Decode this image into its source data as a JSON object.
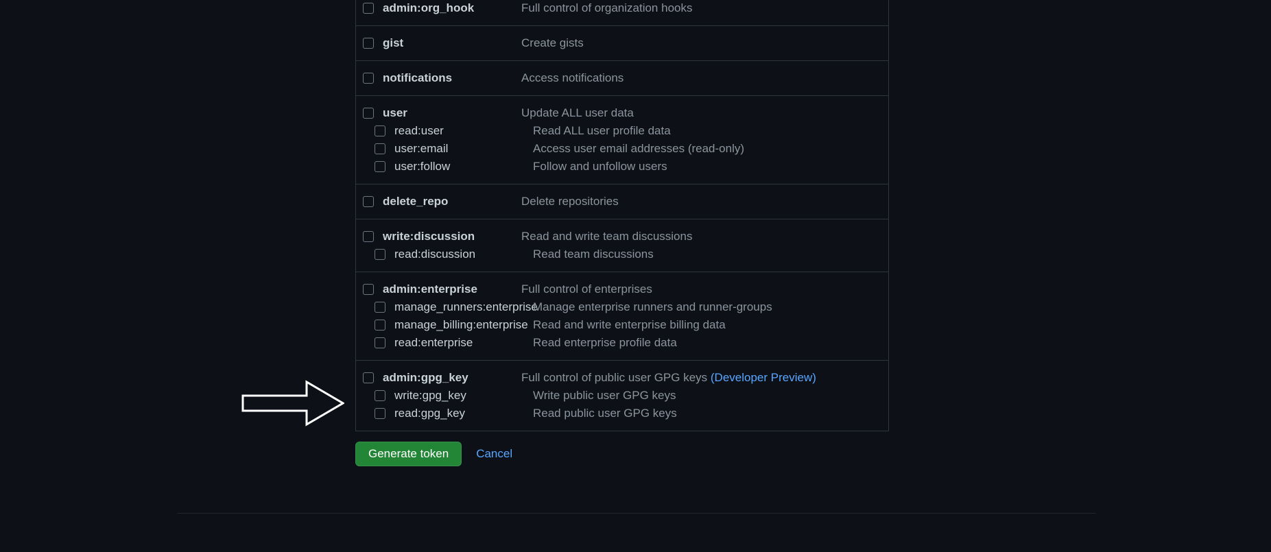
{
  "groups": [
    {
      "rows": [
        {
          "type": "parent",
          "label": "admin:org_hook",
          "desc": "Full control of organization hooks"
        }
      ]
    },
    {
      "rows": [
        {
          "type": "parent",
          "label": "gist",
          "desc": "Create gists"
        }
      ]
    },
    {
      "rows": [
        {
          "type": "parent",
          "label": "notifications",
          "desc": "Access notifications"
        }
      ]
    },
    {
      "rows": [
        {
          "type": "parent",
          "label": "user",
          "desc": "Update ALL user data"
        },
        {
          "type": "child",
          "label": "read:user",
          "desc": "Read ALL user profile data"
        },
        {
          "type": "child",
          "label": "user:email",
          "desc": "Access user email addresses (read-only)"
        },
        {
          "type": "child",
          "label": "user:follow",
          "desc": "Follow and unfollow users"
        }
      ]
    },
    {
      "rows": [
        {
          "type": "parent",
          "label": "delete_repo",
          "desc": "Delete repositories"
        }
      ]
    },
    {
      "rows": [
        {
          "type": "parent",
          "label": "write:discussion",
          "desc": "Read and write team discussions"
        },
        {
          "type": "child",
          "label": "read:discussion",
          "desc": "Read team discussions"
        }
      ]
    },
    {
      "rows": [
        {
          "type": "parent",
          "label": "admin:enterprise",
          "desc": "Full control of enterprises"
        },
        {
          "type": "child",
          "label": "manage_runners:enterprise",
          "desc": "Manage enterprise runners and runner-groups"
        },
        {
          "type": "child",
          "label": "manage_billing:enterprise",
          "desc": "Read and write enterprise billing data"
        },
        {
          "type": "child",
          "label": "read:enterprise",
          "desc": "Read enterprise profile data"
        }
      ]
    },
    {
      "rows": [
        {
          "type": "parent",
          "label": "admin:gpg_key",
          "desc": "Full control of public user GPG keys ",
          "link": "(Developer Preview)"
        },
        {
          "type": "child",
          "label": "write:gpg_key",
          "desc": "Write public user GPG keys"
        },
        {
          "type": "child",
          "label": "read:gpg_key",
          "desc": "Read public user GPG keys"
        }
      ]
    }
  ],
  "actions": {
    "generate": "Generate token",
    "cancel": "Cancel"
  }
}
